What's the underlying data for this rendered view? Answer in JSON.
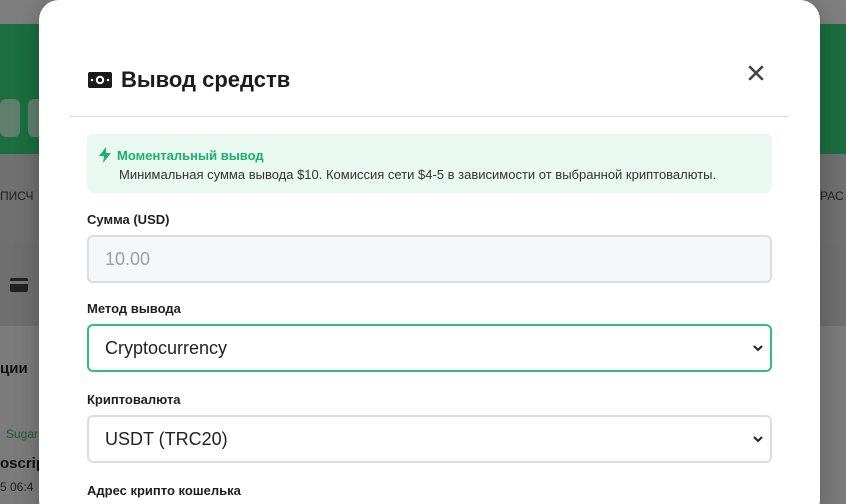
{
  "background": {
    "nav_left_fragment": "ПИСЧ",
    "nav_right_fragment": "РАС",
    "section_heading_fragment": "ции",
    "list_link_fragment": "Sugar",
    "list_title_fragment": "oscrip",
    "list_time_fragment": "5 06:4"
  },
  "modal": {
    "title": "Вывод средств",
    "title_icon": "money-bill-icon",
    "close_icon": "close-icon",
    "info": {
      "icon": "bolt-icon",
      "title": "Моментальный вывод",
      "text": "Минимальная сумма вывода $10. Комиссия сети $4-5 в зависимости от выбранной криптовалюты."
    },
    "amount": {
      "label": "Сумма (USD)",
      "placeholder": "10.00"
    },
    "method": {
      "label": "Метод вывода",
      "value": "Cryptocurrency"
    },
    "crypto": {
      "label": "Криптовалюта",
      "value": "USDT (TRC20)"
    },
    "wallet": {
      "label": "Адрес крипто кошелька"
    }
  },
  "colors": {
    "accent": "#2fbf7a",
    "info_bg": "#e9f8f0",
    "info_title": "#19b36b"
  }
}
